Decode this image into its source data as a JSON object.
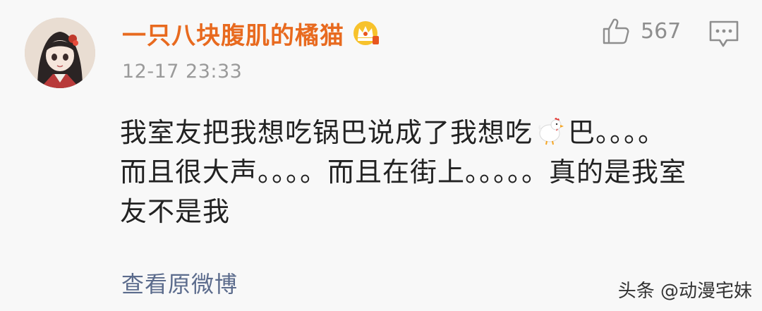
{
  "comment": {
    "username": "一只八块腹肌的橘猫",
    "timestamp": "12-17 23:33",
    "likes": "567",
    "text_line1_a": "我室友把我想吃锅巴说成了我想吃",
    "text_line1_b": "巴。。。。",
    "text_line2": "而且很大声。。。。而且在街上。。。。。真的是我室",
    "text_line3": "友不是我",
    "emoji": "chicken",
    "view_original": "查看原微博"
  },
  "icons": {
    "badge": "vip-crown-icon",
    "like": "thumbs-up-icon",
    "comment": "comment-icon"
  },
  "watermark": "头条 @动漫宅妹",
  "colors": {
    "username": "#e86a1f",
    "timestamp": "#9a9a9a",
    "link": "#5b6b8c",
    "background": "#f8f8f8"
  }
}
